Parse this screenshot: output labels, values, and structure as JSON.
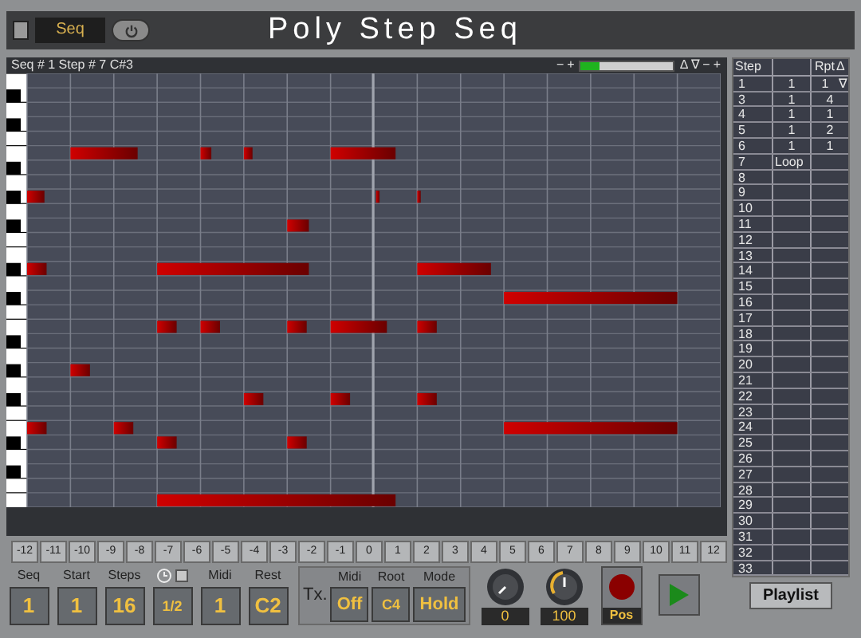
{
  "header": {
    "checkbox": {
      "checked": false
    },
    "seq_field": "Seq",
    "title": "Poly Step Seq"
  },
  "info": {
    "text": "Seq # 1 Step # 7  C#3",
    "zoom_out": "−",
    "zoom_in": "+",
    "meter": {
      "level": 0.2
    },
    "up": "Δ",
    "down": "∇",
    "minus": "−",
    "plus": "+"
  },
  "transpose": [
    "-12",
    "-11",
    "-10",
    "-9",
    "-8",
    "-7",
    "-6",
    "-5",
    "-4",
    "-3",
    "-2",
    "-1",
    "0",
    "1",
    "2",
    "3",
    "4",
    "5",
    "6",
    "7",
    "8",
    "9",
    "10",
    "11",
    "12"
  ],
  "controls": [
    {
      "kind": "value",
      "label": "Seq",
      "value": "1"
    },
    {
      "kind": "value",
      "label": "Start",
      "value": "1"
    },
    {
      "kind": "value",
      "label": "Steps",
      "value": "16"
    },
    {
      "kind": "clock",
      "checked": false,
      "value": "1/2"
    },
    {
      "kind": "value",
      "label": "Midi",
      "value": "1"
    },
    {
      "kind": "value",
      "label": "Rest",
      "value": "C2"
    }
  ],
  "tx": {
    "label": "Tx.",
    "fields": [
      {
        "label": "Midi",
        "value": "Off"
      },
      {
        "label": "Root",
        "value": "C4"
      },
      {
        "label": "Mode",
        "value": "Hold"
      }
    ]
  },
  "knobs": [
    {
      "reading": "0"
    },
    {
      "reading": "100"
    }
  ],
  "record": {
    "label": "Pos"
  },
  "step_table": {
    "step_header": "Step",
    "repeat_header": "Rpt",
    "up": "Δ",
    "down": "∇",
    "rows": [
      {
        "step": "1",
        "column_2": "1",
        "repeat": "1"
      },
      {
        "step": "3",
        "column_2": "1",
        "repeat": "4"
      },
      {
        "step": "4",
        "column_2": "1",
        "repeat": "1"
      },
      {
        "step": "5",
        "column_2": "1",
        "repeat": "2"
      },
      {
        "step": "6",
        "column_2": "1",
        "repeat": "1"
      },
      {
        "step": "7",
        "column_2": "Loop"
      },
      {
        "step": "8"
      },
      {
        "step": "9"
      },
      {
        "step": "10"
      },
      {
        "step": "11"
      },
      {
        "step": "12"
      },
      {
        "step": "13"
      },
      {
        "step": "14"
      },
      {
        "step": "15"
      },
      {
        "step": "16"
      },
      {
        "step": "17"
      },
      {
        "step": "18"
      },
      {
        "step": "19"
      },
      {
        "step": "20"
      },
      {
        "step": "21"
      },
      {
        "step": "22"
      },
      {
        "step": "23"
      },
      {
        "step": "24"
      },
      {
        "step": "25"
      },
      {
        "step": "26"
      },
      {
        "step": "27"
      },
      {
        "step": "28"
      },
      {
        "step": "29"
      },
      {
        "step": "30"
      },
      {
        "step": "31"
      },
      {
        "step": "32"
      },
      {
        "step": "33"
      }
    ]
  },
  "playlist": "Playlist"
}
